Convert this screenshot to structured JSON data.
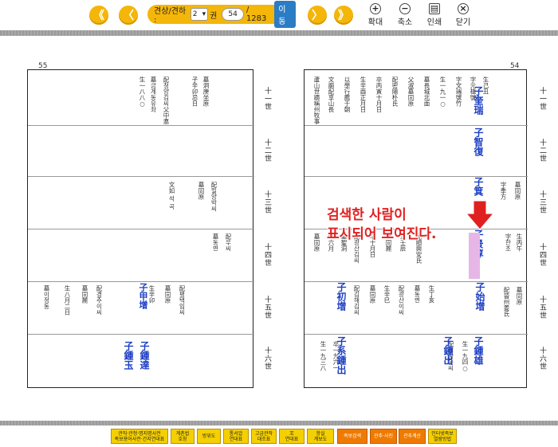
{
  "toolbar": {
    "vol_label": "권",
    "vol_value": "2",
    "page_value": "54",
    "total_pages": "/ 1283",
    "go_label": "이동",
    "search_hint": "견상/견하 :",
    "zoom_in_label": "확대",
    "zoom_out_label": "축소",
    "print_label": "인쇄",
    "close_label": "닫기",
    "nav": {
      "first": "《",
      "prev": "〈",
      "next": "〉",
      "last": "》"
    }
  },
  "pages": {
    "left_number": "55",
    "right_number": "54"
  },
  "generations": [
    "十一世",
    "十二世",
    "十三世",
    "十四世",
    "十五世",
    "十六世"
  ],
  "right_page": {
    "names": [
      {
        "text": "子奎瑞",
        "note": "規平"
      },
      {
        "text": "子智復"
      },
      {
        "text": "子箕"
      },
      {
        "text": "子景淳"
      },
      {
        "text": "子始增"
      },
      {
        "text": "子鍾雄"
      },
      {
        "text": "子初增"
      },
      {
        "text": "子鍾出"
      },
      {
        "text": "子系鍾出"
      }
    ]
  },
  "left_page": {
    "names": [
      {
        "text": "子甲增"
      },
      {
        "text": "子鍾達"
      },
      {
        "text": "子鍾玉"
      }
    ]
  },
  "overlay": {
    "line1": "검색한 사람이",
    "line2": "표시되어 보여진다."
  },
  "bottom_buttons": [
    {
      "label": "관직·관청·명지명사전\n족보용어사전·간지연대표",
      "color": "yellow"
    },
    {
      "label": "계촌법\n호칭",
      "color": "yellow"
    },
    {
      "label": "방위도",
      "color": "yellow"
    },
    {
      "label": "통서압\n연대표",
      "color": "yellow"
    },
    {
      "label": "고금관작\n대조표",
      "color": "yellow"
    },
    {
      "label": "王\n연대표",
      "color": "yellow"
    },
    {
      "label": "항실\n계보도",
      "color": "yellow"
    },
    {
      "label": "족보검색",
      "color": "orange"
    },
    {
      "label": "관추·사진",
      "color": "orange"
    },
    {
      "label": "관추계산",
      "color": "orange"
    },
    {
      "label": "인터넷족보\n열람방법",
      "color": "yellow"
    }
  ],
  "colors": {
    "accent": "#f5b60a",
    "go_button": "#2a7cc4",
    "overlay_text": "#e02020",
    "name_blue": "#1d3fc4",
    "highlight": "#e6b7e6"
  },
  "icons": [
    "double-left-arrow-icon",
    "left-arrow-icon",
    "right-arrow-icon",
    "double-right-arrow-icon",
    "zoom-in-icon",
    "zoom-out-icon",
    "printer-icon",
    "close-icon",
    "red-down-arrow-icon"
  ]
}
